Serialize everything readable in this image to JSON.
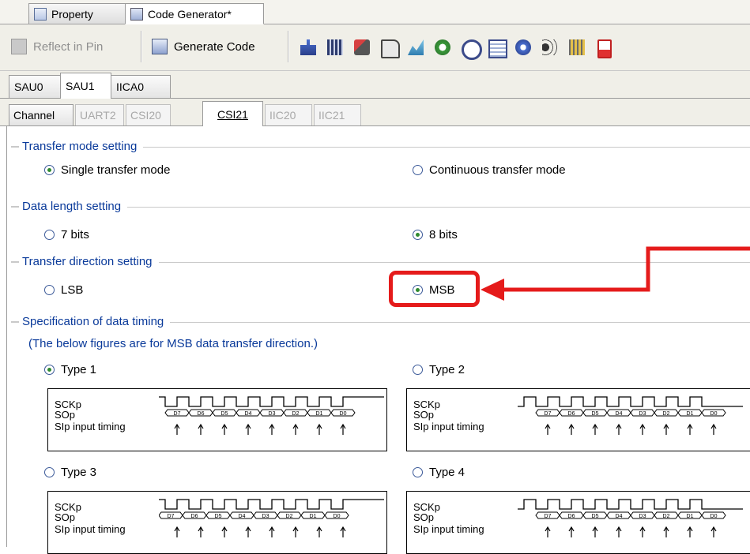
{
  "doc_tabs": [
    {
      "label": "Property",
      "active": false
    },
    {
      "label": "Code Generator*",
      "active": true
    }
  ],
  "toolbar": {
    "reflect_label": "Reflect in Pin",
    "generate_label": "Generate Code",
    "icons": [
      "clock-tree-icon",
      "chip-icon",
      "peripheral-icon",
      "port-icon",
      "interrupt-icon",
      "timer-icon",
      "link-icon",
      "memory-icon",
      "watchdog-icon",
      "sound-icon",
      "bus-icon",
      "battery-icon"
    ]
  },
  "unit_tabs": [
    {
      "label": "SAU0",
      "active": false
    },
    {
      "label": "SAU1",
      "active": true
    },
    {
      "label": "IICA0",
      "active": false
    }
  ],
  "channel_tabs": [
    {
      "label": "Channel",
      "state": "normal"
    },
    {
      "label": "UART2",
      "state": "disabled"
    },
    {
      "label": "CSI20",
      "state": "disabled"
    },
    {
      "label": "CSI21",
      "state": "active"
    },
    {
      "label": "IIC20",
      "state": "disabled"
    },
    {
      "label": "IIC21",
      "state": "disabled"
    }
  ],
  "transfer_mode": {
    "title": "Transfer mode setting",
    "single": "Single transfer mode",
    "continuous": "Continuous transfer mode",
    "selected": "single"
  },
  "data_length": {
    "title": "Data length setting",
    "seven": "7 bits",
    "eight": "8 bits",
    "selected": "eight"
  },
  "transfer_direction": {
    "title": "Transfer direction setting",
    "lsb": "LSB",
    "msb": "MSB",
    "selected": "msb"
  },
  "data_timing": {
    "title": "Specification of data timing",
    "note": "(The below figures are for MSB data transfer direction.)",
    "types": [
      {
        "label": "Type 1",
        "selected": true
      },
      {
        "label": "Type 2",
        "selected": false
      },
      {
        "label": "Type 3",
        "selected": false
      },
      {
        "label": "Type 4",
        "selected": false
      }
    ],
    "signal_sck": "SCKp",
    "signal_so": "SOp",
    "signal_si": "SIp input timing",
    "bits": [
      "D7",
      "D6",
      "D5",
      "D4",
      "D3",
      "D2",
      "D1",
      "D0"
    ]
  },
  "accent": {
    "highlight": "#e51b1b",
    "group_title": "#0a3a9a",
    "radio_dot": "#2f8a2f"
  }
}
